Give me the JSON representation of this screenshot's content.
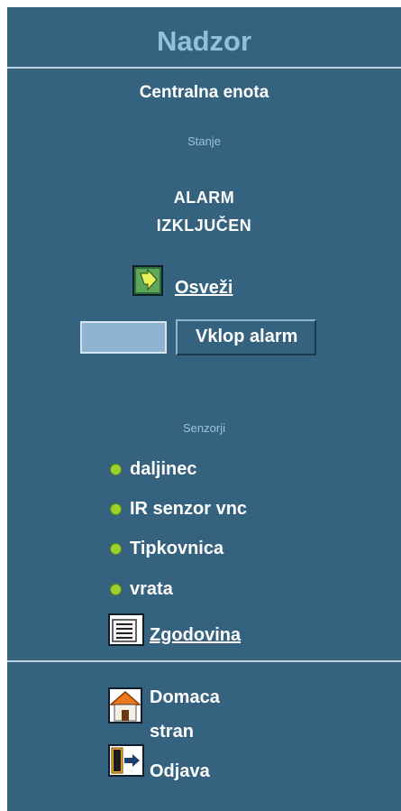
{
  "header": {
    "title": "Nadzor"
  },
  "unit": {
    "name": "Centralna enota",
    "state_label": "Stanje",
    "status_line1": "ALARM",
    "status_line2": "IZKLJUČEN",
    "refresh_label": "Osveži",
    "code_input_value": "",
    "arm_button_label": "Vklop alarm"
  },
  "sensors": {
    "label": "Senzorji",
    "items": [
      {
        "name": "daljinec",
        "status_color": "#9bd12e"
      },
      {
        "name": "IR senzor vnc",
        "status_color": "#9bd12e"
      },
      {
        "name": "Tipkovnica",
        "status_color": "#9bd12e"
      },
      {
        "name": "vrata",
        "status_color": "#9bd12e"
      }
    ],
    "history_label": "Zgodovina"
  },
  "footer": {
    "home_line1": "Domaca",
    "home_line2": "stran",
    "logout_label": "Odjava"
  },
  "icons": {
    "refresh": "refresh-arrow-icon",
    "history": "history-list-icon",
    "home": "home-icon",
    "logout": "logout-door-icon"
  },
  "colors": {
    "panel_bg": "#34627f",
    "title": "#8fc0dc",
    "section_label": "#9cc4dc",
    "sensor_ok": "#9bd12e"
  }
}
